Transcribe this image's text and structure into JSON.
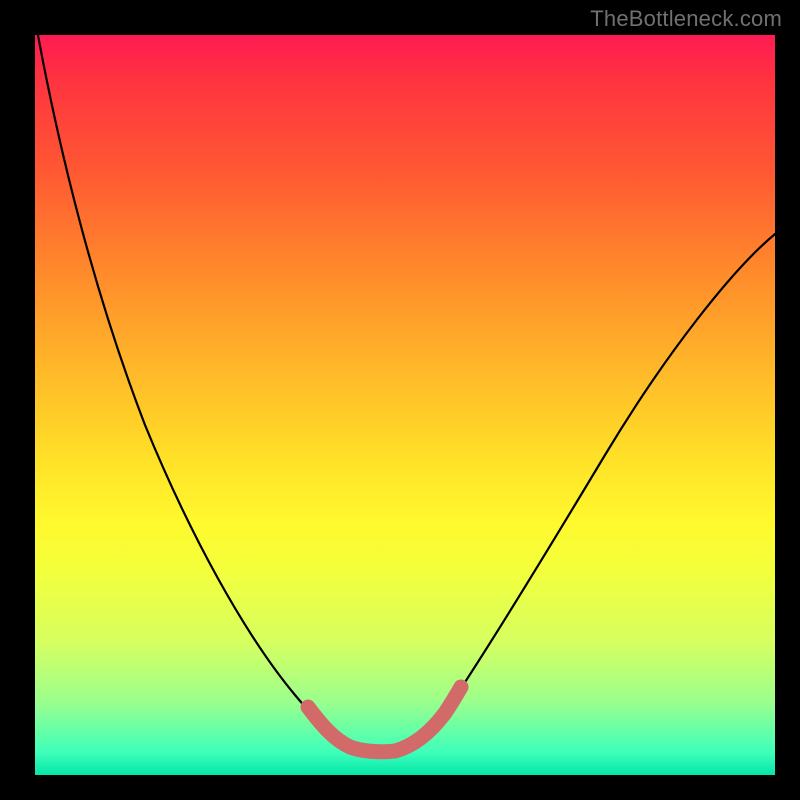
{
  "watermark": "TheBottleneck.com",
  "chart_data": {
    "type": "line",
    "title": "",
    "xlabel": "",
    "ylabel": "",
    "xlim": [
      0,
      1
    ],
    "ylim": [
      0,
      1
    ],
    "series": [
      {
        "name": "main-curve",
        "x": [
          0.0,
          0.02,
          0.05,
          0.09,
          0.13,
          0.18,
          0.24,
          0.3,
          0.34,
          0.37,
          0.4,
          0.42,
          0.48,
          0.5,
          0.55,
          0.6,
          0.68,
          0.78,
          0.9,
          1.0
        ],
        "values": [
          1.0,
          0.9,
          0.78,
          0.65,
          0.54,
          0.41,
          0.27,
          0.15,
          0.09,
          0.06,
          0.04,
          0.03,
          0.03,
          0.04,
          0.08,
          0.14,
          0.25,
          0.4,
          0.58,
          0.73
        ]
      },
      {
        "name": "highlight-segment",
        "x": [
          0.37,
          0.38,
          0.4,
          0.42,
          0.45,
          0.48,
          0.5,
          0.52,
          0.54,
          0.56
        ],
        "values": [
          0.065,
          0.05,
          0.04,
          0.032,
          0.03,
          0.032,
          0.04,
          0.055,
          0.075,
          0.095
        ]
      }
    ],
    "colors": {
      "main_curve": "#000000",
      "highlight": "#d36a6a",
      "gradient_top": "#ff1a53",
      "gradient_bottom": "#04e6a8"
    }
  }
}
